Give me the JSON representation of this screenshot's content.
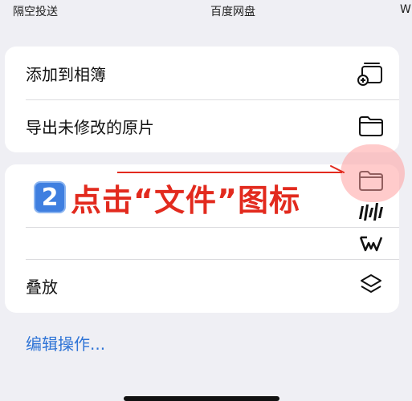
{
  "topbar": {
    "left": "隔空投送",
    "center": "百度网盘",
    "right": "W"
  },
  "card1": {
    "rows": [
      {
        "label": "添加到相簿",
        "icon": "add-to-album-icon"
      },
      {
        "label": "导出未修改的原片",
        "icon": "folder-icon"
      }
    ]
  },
  "card2": {
    "rows": [
      {
        "label": "",
        "icon": "folder-icon"
      },
      {
        "label": "",
        "icon": "dolby-icon"
      },
      {
        "label": "",
        "icon": "wps-icon"
      },
      {
        "label": "叠放",
        "icon": "shortcuts-icon"
      }
    ]
  },
  "annotation": {
    "badge": "2",
    "text": "点击“文件”图标",
    "color": "#e22a1e"
  },
  "edit_actions": "编辑操作..."
}
